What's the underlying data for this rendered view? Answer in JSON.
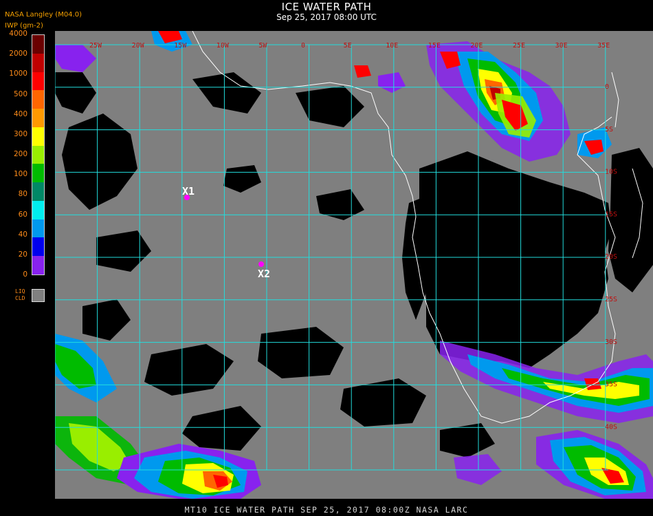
{
  "header": {
    "title": "ICE WATER PATH",
    "subtitle": "Sep 25, 2017 08:00 UTC",
    "org": "NASA Langley (M04.0)",
    "unit_label": "IWP (gm-2)"
  },
  "legend": {
    "labels": [
      "4000",
      "2000",
      "1000",
      "500",
      "400",
      "300",
      "200",
      "100",
      "80",
      "60",
      "40",
      "20",
      "0"
    ],
    "colors": [
      "#6a0000",
      "#c00000",
      "#ff0000",
      "#ff6600",
      "#ff9900",
      "#ffff00",
      "#99ee00",
      "#00bb00",
      "#008866",
      "#00eeee",
      "#0099ee",
      "#0000ee",
      "#8822ee"
    ],
    "liq_label_1": "LIQ",
    "liq_label_2": "CLD",
    "liq_color": "#808080"
  },
  "map": {
    "background_color": "#7f7f7f",
    "clear_color": "#000000",
    "grid_color": "#22dddd",
    "coast_color": "#ffffff",
    "markers": [
      {
        "label": "X1"
      },
      {
        "label": "X2"
      }
    ],
    "lon_labels": [
      "25W",
      "20W",
      "15W",
      "10W",
      "5W",
      "0",
      "5E",
      "10E",
      "15E",
      "20E",
      "25E",
      "30E",
      "35E"
    ],
    "lat_labels": [
      "0",
      "5S",
      "10S",
      "15S",
      "20S",
      "25S",
      "30S",
      "35S",
      "40S"
    ]
  },
  "footer": {
    "text": "MT10  ICE WATER PATH  SEP 25, 2017 08:00Z  NASA LARC"
  }
}
